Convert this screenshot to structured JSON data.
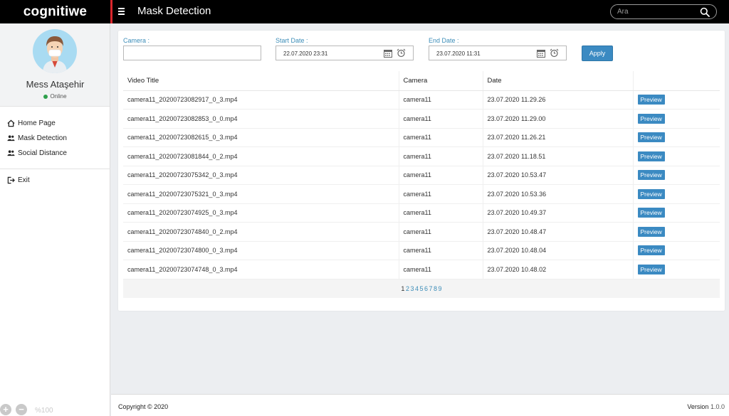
{
  "app": {
    "logo": "cognitiwe",
    "page_title": "Mask Detection",
    "search_placeholder": "Ara"
  },
  "sidebar": {
    "user_name": "Mess Ataşehir",
    "status": "Online",
    "items": [
      {
        "label": "Home Page",
        "icon": "home-icon"
      },
      {
        "label": "Mask Detection",
        "icon": "users-icon"
      },
      {
        "label": "Social Distance",
        "icon": "users-icon"
      }
    ],
    "exit_label": "Exit",
    "zoom_level": "%100"
  },
  "filters": {
    "camera_label": "Camera :",
    "camera_value": "",
    "start_label": "Start Date :",
    "start_value": "22.07.2020 23:31",
    "end_label": "End Date :",
    "end_value": "23.07.2020 11:31",
    "apply_label": "Apply"
  },
  "table": {
    "headers": [
      "Video Title",
      "Camera",
      "Date",
      ""
    ],
    "preview_label": "Preview",
    "rows": [
      {
        "title": "camera11_20200723082917_0_3.mp4",
        "camera": "camera11",
        "date": "23.07.2020 11.29.26"
      },
      {
        "title": "camera11_20200723082853_0_0.mp4",
        "camera": "camera11",
        "date": "23.07.2020 11.29.00"
      },
      {
        "title": "camera11_20200723082615_0_3.mp4",
        "camera": "camera11",
        "date": "23.07.2020 11.26.21"
      },
      {
        "title": "camera11_20200723081844_0_2.mp4",
        "camera": "camera11",
        "date": "23.07.2020 11.18.51"
      },
      {
        "title": "camera11_20200723075342_0_3.mp4",
        "camera": "camera11",
        "date": "23.07.2020 10.53.47"
      },
      {
        "title": "camera11_20200723075321_0_3.mp4",
        "camera": "camera11",
        "date": "23.07.2020 10.53.36"
      },
      {
        "title": "camera11_20200723074925_0_3.mp4",
        "camera": "camera11",
        "date": "23.07.2020 10.49.37"
      },
      {
        "title": "camera11_20200723074840_0_2.mp4",
        "camera": "camera11",
        "date": "23.07.2020 10.48.47"
      },
      {
        "title": "camera11_20200723074800_0_3.mp4",
        "camera": "camera11",
        "date": "23.07.2020 10.48.04"
      },
      {
        "title": "camera11_20200723074748_0_3.mp4",
        "camera": "camera11",
        "date": "23.07.2020 10.48.02"
      }
    ],
    "pages": [
      "1",
      "2",
      "3",
      "4",
      "5",
      "6",
      "7",
      "8",
      "9"
    ],
    "current_page": "1"
  },
  "footer": {
    "copyright": "Copyright © 2020",
    "version_label": "Version",
    "version_number": "1.0.0"
  },
  "colors": {
    "accent": "#3b8ac2",
    "top_bar": "#000000",
    "top_separator": "#d9262c",
    "online": "#2ea04c"
  }
}
